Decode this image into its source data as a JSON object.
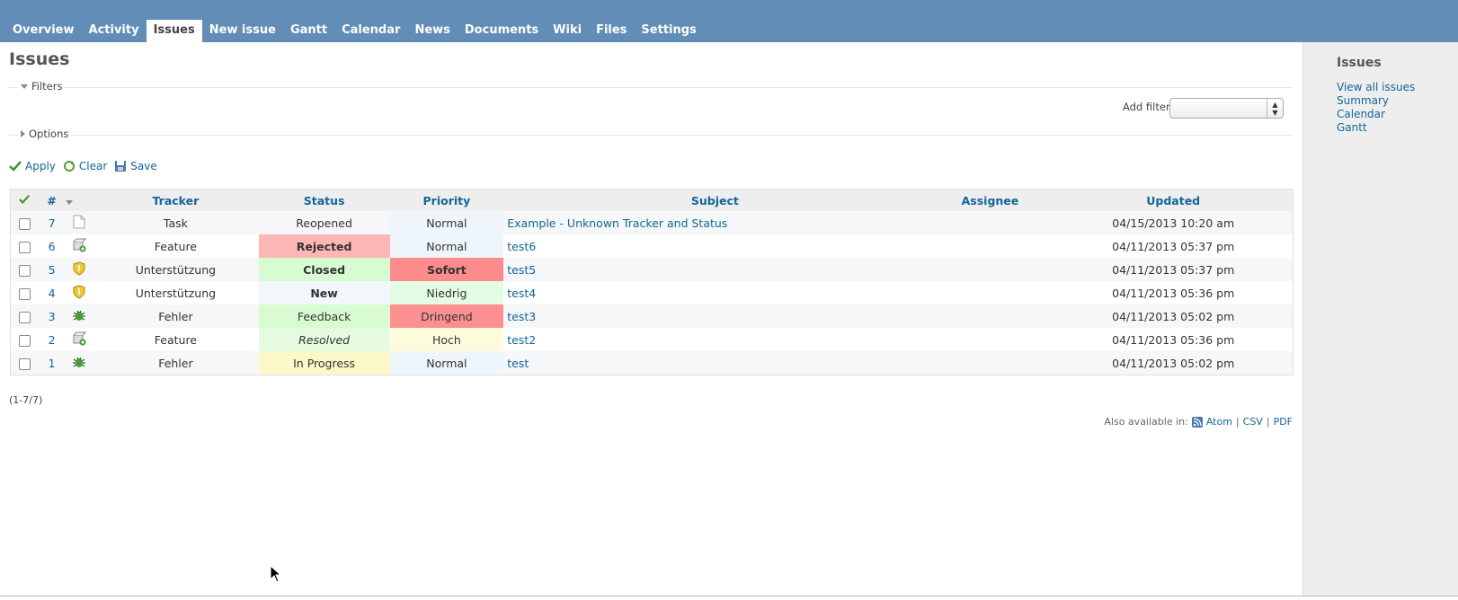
{
  "tabs": [
    {
      "label": "Overview",
      "selected": false
    },
    {
      "label": "Activity",
      "selected": false
    },
    {
      "label": "Issues",
      "selected": true
    },
    {
      "label": "New issue",
      "selected": false
    },
    {
      "label": "Gantt",
      "selected": false
    },
    {
      "label": "Calendar",
      "selected": false
    },
    {
      "label": "News",
      "selected": false
    },
    {
      "label": "Documents",
      "selected": false
    },
    {
      "label": "Wiki",
      "selected": false
    },
    {
      "label": "Files",
      "selected": false
    },
    {
      "label": "Settings",
      "selected": false
    }
  ],
  "page_title": "Issues",
  "filters": {
    "legend": "Filters",
    "add_filter_label": "Add filter",
    "add_filter_value": ""
  },
  "options": {
    "legend": "Options"
  },
  "actions": {
    "apply": "Apply",
    "clear": "Clear",
    "save": "Save"
  },
  "table": {
    "headers": {
      "id": "#",
      "tracker": "Tracker",
      "status": "Status",
      "priority": "Priority",
      "subject": "Subject",
      "assignee": "Assignee",
      "updated": "Updated"
    },
    "rows": [
      {
        "id": "7",
        "icon": "document-icon",
        "tracker": "Task",
        "status": "Reopened",
        "status_bg": "",
        "status_style": "normal",
        "priority": "Normal",
        "priority_bg": "#eef6fc",
        "priority_style": "normal",
        "subject": "Example - Unknown Tracker and Status",
        "assignee": "",
        "updated": "04/15/2013 10:20 am"
      },
      {
        "id": "6",
        "icon": "feature-package-icon",
        "tracker": "Feature",
        "status": "Rejected",
        "status_bg": "#ffb6b6",
        "status_style": "bold",
        "priority": "Normal",
        "priority_bg": "#eef6fc",
        "priority_style": "normal",
        "subject": "test6",
        "assignee": "",
        "updated": "04/11/2013 05:37 pm"
      },
      {
        "id": "5",
        "icon": "support-shield-icon",
        "tracker": "Unterstützung",
        "status": "Closed",
        "status_bg": "#d8fcd2",
        "status_style": "bold",
        "priority": "Sofort",
        "priority_bg": "#fc8c8c",
        "priority_style": "bold",
        "subject": "test5",
        "assignee": "",
        "updated": "04/11/2013 05:37 pm"
      },
      {
        "id": "4",
        "icon": "support-shield-icon",
        "tracker": "Unterstützung",
        "status": "New",
        "status_bg": "#f2f7fc",
        "status_style": "bold",
        "priority": "Niedrig",
        "priority_bg": "#e4fbe4",
        "priority_style": "normal",
        "subject": "test4",
        "assignee": "",
        "updated": "04/11/2013 05:36 pm"
      },
      {
        "id": "3",
        "icon": "bug-icon",
        "tracker": "Fehler",
        "status": "Feedback",
        "status_bg": "#d8fbd2",
        "status_style": "normal",
        "priority": "Dringend",
        "priority_bg": "#fc9090",
        "priority_style": "normal",
        "subject": "test3",
        "assignee": "",
        "updated": "04/11/2013 05:02 pm"
      },
      {
        "id": "2",
        "icon": "feature-package-icon",
        "tracker": "Feature",
        "status": "Resolved",
        "status_bg": "#e4fbe0",
        "status_style": "italic",
        "priority": "Hoch",
        "priority_bg": "#fefbdc",
        "priority_style": "normal",
        "subject": "test2",
        "assignee": "",
        "updated": "04/11/2013 05:36 pm"
      },
      {
        "id": "1",
        "icon": "bug-icon",
        "tracker": "Fehler",
        "status": "In Progress",
        "status_bg": "#fdf8c8",
        "status_style": "normal",
        "priority": "Normal",
        "priority_bg": "#eef6fc",
        "priority_style": "normal",
        "subject": "test",
        "assignee": "",
        "updated": "04/11/2013 05:02 pm"
      }
    ]
  },
  "count": "(1-7/7)",
  "other_formats": {
    "label": "Also available in:",
    "atom": "Atom",
    "csv": "CSV",
    "pdf": "PDF",
    "sep": "|"
  },
  "sidebar": {
    "title": "Issues",
    "links": [
      "View all issues",
      "Summary",
      "Calendar",
      "Gantt"
    ]
  },
  "colors": {
    "header": "#628db6",
    "link": "#116699",
    "sidebar": "#eeeeee"
  }
}
